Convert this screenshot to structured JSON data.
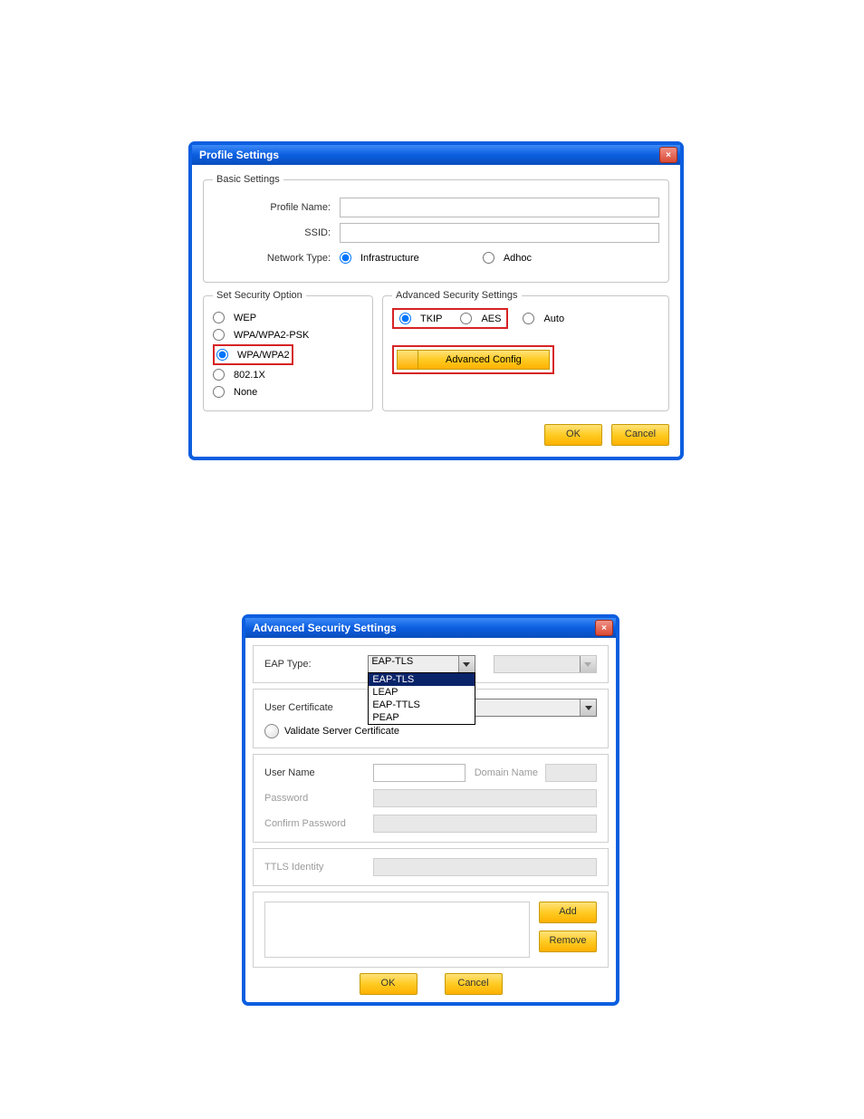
{
  "dialog1": {
    "title": "Profile Settings",
    "basic": {
      "legend": "Basic Settings",
      "profile_name_label": "Profile Name:",
      "profile_name_value": "",
      "ssid_label": "SSID:",
      "ssid_value": "",
      "network_type_label": "Network Type:",
      "infrastructure_label": "Infrastructure",
      "adhoc_label": "Adhoc"
    },
    "security": {
      "legend": "Set Security Option",
      "wep": "WEP",
      "wpa_psk": "WPA/WPA2-PSK",
      "wpa": "WPA/WPA2",
      "dot1x": "802.1X",
      "none": "None"
    },
    "advanced": {
      "legend": "Advanced Security Settings",
      "tkip": "TKIP",
      "aes": "AES",
      "auto": "Auto",
      "config_btn": "Advanced Config"
    },
    "ok": "OK",
    "cancel": "Cancel"
  },
  "dialog2": {
    "title": "Advanced Security Settings",
    "eap_type_label": "EAP Type:",
    "eap_type_value": "EAP-TLS",
    "eap_options": {
      "opt1": "EAP-TLS",
      "opt2": "LEAP",
      "opt3": "EAP-TTLS",
      "opt4": "PEAP"
    },
    "user_cert_label": "User Certificate",
    "validate_label": "Validate Server Certificate",
    "user_name_label": "User Name",
    "domain_name_label": "Domain Name",
    "password_label": "Password",
    "confirm_password_label": "Confirm Password",
    "ttls_identity_label": "TTLS Identity",
    "add": "Add",
    "remove": "Remove",
    "ok": "OK",
    "cancel": "Cancel"
  }
}
